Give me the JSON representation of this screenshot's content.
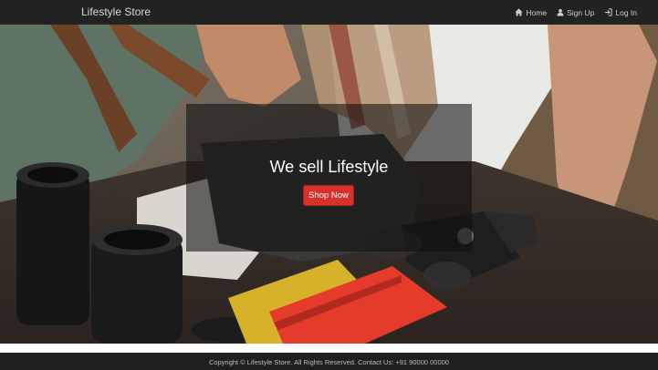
{
  "navbar": {
    "brand": "Lifestyle Store",
    "links": [
      {
        "label": "Home",
        "icon": "home-icon"
      },
      {
        "label": "Sign Up",
        "icon": "user-icon"
      },
      {
        "label": "Log In",
        "icon": "login-icon"
      }
    ]
  },
  "hero": {
    "headline": "We sell Lifestyle",
    "cta_label": "Shop Now"
  },
  "footer": {
    "text": "Copyright © Lifestyle Store. All Rights Reserved. Contact Us: +91 90000 00000"
  },
  "colors": {
    "navbar_bg": "#222222",
    "cta_bg": "#d7322a",
    "overlay": "rgba(15,15,15,0.58)",
    "footer_bg": "#1f1f1f"
  }
}
